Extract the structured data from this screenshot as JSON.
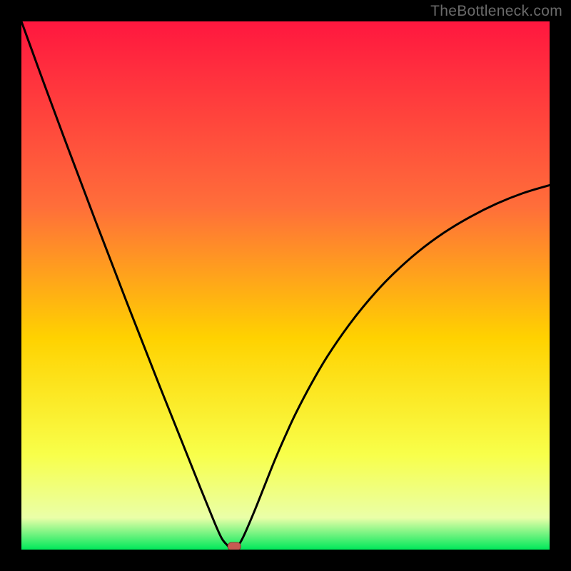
{
  "watermark": "TheBottleneck.com",
  "colors": {
    "frame": "#000000",
    "gradient_top": "#ff173f",
    "gradient_mid_upper": "#ff6e3a",
    "gradient_mid": "#ffd200",
    "gradient_mid_lower": "#f8ff4a",
    "gradient_low": "#eaffa8",
    "gradient_bottom": "#00e85a",
    "curve": "#000000",
    "marker_fill": "#c85a52",
    "marker_stroke": "#8f3a34"
  },
  "chart_data": {
    "type": "line",
    "title": "",
    "xlabel": "",
    "ylabel": "",
    "xlim": [
      0,
      100
    ],
    "ylim": [
      0,
      100
    ],
    "minimum_x": 40,
    "curve": {
      "x": [
        0,
        2,
        4,
        6,
        8,
        10,
        12,
        14,
        16,
        18,
        20,
        22,
        24,
        26,
        28,
        30,
        32,
        34,
        36,
        37,
        38,
        39,
        39.5,
        40,
        40.8,
        42,
        44,
        46,
        48,
        50,
        52,
        55,
        58,
        62,
        66,
        70,
        75,
        80,
        85,
        90,
        95,
        100
      ],
      "y": [
        100,
        94.5,
        89.0,
        83.6,
        78.2,
        72.9,
        67.6,
        62.3,
        57.1,
        51.9,
        46.7,
        41.6,
        36.5,
        31.4,
        26.4,
        21.4,
        16.4,
        11.4,
        6.5,
        4.1,
        2.0,
        0.8,
        0.3,
        0.0,
        0.4,
        2.4,
        7.0,
        12.0,
        17.0,
        21.6,
        25.9,
        31.6,
        36.7,
        42.5,
        47.5,
        51.8,
        56.3,
        60.0,
        63.0,
        65.5,
        67.5,
        69.0
      ]
    },
    "marker": {
      "x": 40.3,
      "y": 0.6
    }
  }
}
